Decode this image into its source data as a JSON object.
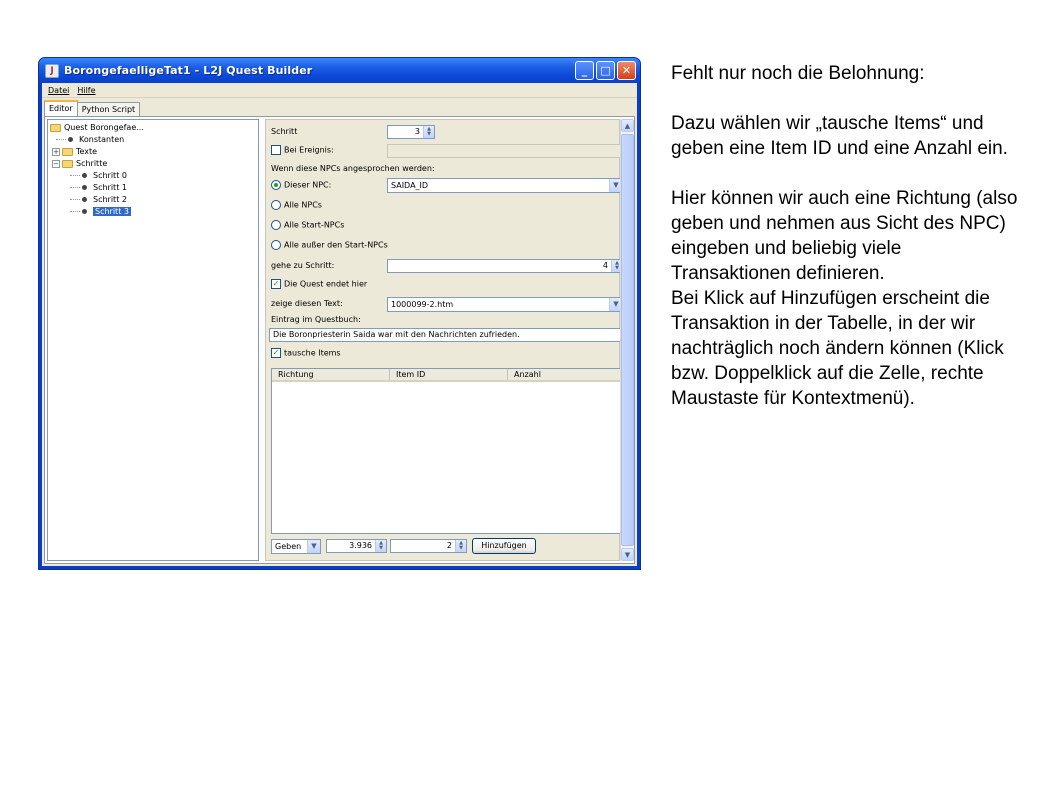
{
  "window": {
    "title": "BorongefaelligeTat1 - L2J Quest Builder",
    "controls": {
      "minimize": "_",
      "maximize": "□",
      "close": "✕"
    }
  },
  "menubar": {
    "items": [
      "Datei",
      "Hilfe"
    ]
  },
  "tabs": [
    {
      "label": "Editor",
      "active": true
    },
    {
      "label": "Python Script",
      "active": false
    }
  ],
  "tree": {
    "root": "Quest Borongefae...",
    "constants": "Konstanten",
    "texts": "Texte",
    "steps": "Schritte",
    "step_items": [
      "Schritt 0",
      "Schritt 1",
      "Schritt 2",
      "Schritt 3"
    ],
    "selected": "Schritt 3"
  },
  "form": {
    "schritt_label": "Schritt",
    "schritt_value": "3",
    "bei_ereignis_label": "Bei Ereignis:",
    "bei_ereignis_checked": false,
    "npc_heading": "Wenn diese NPCs angesprochen werden:",
    "radio_dieser_npc": "Dieser NPC:",
    "radio_alle_npcs": "Alle NPCs",
    "radio_alle_start": "Alle Start-NPCs",
    "radio_alle_ausser": "Alle außer den Start-NPCs",
    "npc_selected": "SAIDA_ID",
    "gehe_zu_label": "gehe zu Schritt:",
    "gehe_zu_value": "4",
    "quest_endet_label": "Die Quest endet hier",
    "quest_endet_checked": true,
    "zeige_text_label": "zeige diesen Text:",
    "zeige_text_value": "1000099-2.htm",
    "eintrag_label": "Eintrag im Questbuch:",
    "eintrag_value": "Die Boronpriesterin Saida war mit den Nachrichten zufrieden.",
    "tausche_label": "tausche Items",
    "tausche_checked": true,
    "table_headers": [
      "Richtung",
      "Item ID",
      "Anzahl"
    ],
    "direction_value": "Geben",
    "item_id_value": "3.936",
    "amount_value": "2",
    "add_button": "Hinzufügen"
  },
  "explanation": {
    "p1": "Fehlt nur noch die Belohnung:",
    "p2": "Dazu wählen wir „tausche Items“ und geben eine Item ID und eine Anzahl ein.",
    "p3": "Hier können wir auch eine Richtung (also geben und nehmen aus Sicht des NPC) eingeben und beliebig viele Transaktionen definieren.",
    "p4": "Bei Klick auf Hinzufügen erscheint die Transaktion in der Tabelle, in der wir nachträglich noch ändern können (Klick bzw. Doppelklick auf die Zelle, rechte Maustaste für Kontextmenü)."
  }
}
